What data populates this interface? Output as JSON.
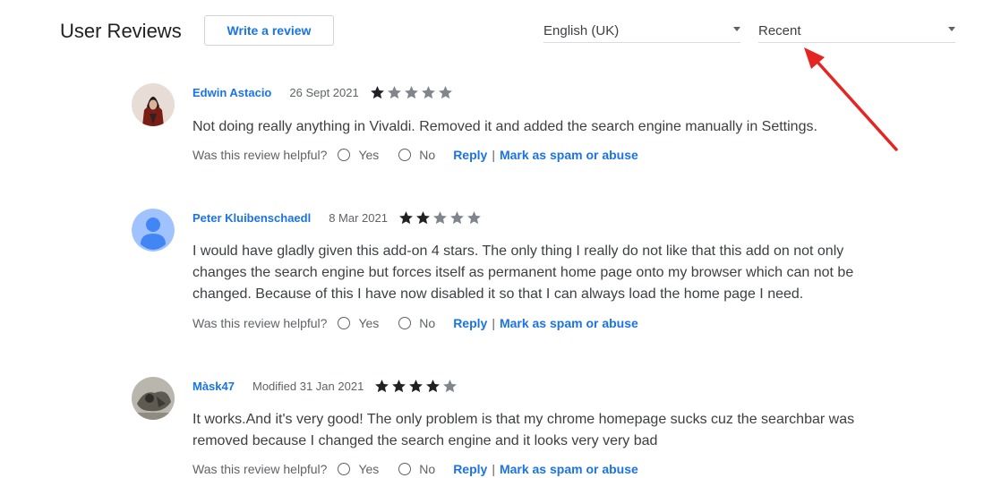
{
  "header": {
    "title": "User Reviews",
    "write_review_label": "Write a review",
    "language_select": {
      "value": "English (UK)"
    },
    "sort_select": {
      "value": "Recent"
    }
  },
  "reviews": [
    {
      "author": "Edwin Astacio",
      "date": "26 Sept 2021",
      "rating": 1,
      "text": "Not doing really anything in Vivaldi. Removed it and added the search engine manually in Settings.",
      "avatar": "dark-figure-avatar"
    },
    {
      "author": "Peter Kluibenschaedl",
      "date": "8 Mar 2021",
      "rating": 2,
      "text": "I would have gladly given this add-on 4 stars. The only thing I really do not like that this add on not only changes the search engine but forces itself as permanent home page onto my browser which can not be changed. Because of this I have now disabled it so that I can always load the home page I need.",
      "avatar": "default-person-avatar"
    },
    {
      "author": "Màsk47",
      "date": "Modified 31 Jan 2021",
      "rating": 4,
      "text": "It works.And it's very good! The only problem is that my chrome homepage sucks cuz the searchbar was removed because I changed the search engine and it looks very very bad",
      "avatar": "sketch-photo-avatar"
    }
  ],
  "helpful": {
    "question": "Was this review helpful?",
    "yes": "Yes",
    "no": "No",
    "reply": "Reply",
    "separator": "|",
    "spam": "Mark as spam or abuse"
  },
  "colors": {
    "link": "#1a73e8",
    "star_filled": "#202124",
    "star_empty": "#80868b",
    "annotation_arrow": "#e52521"
  }
}
